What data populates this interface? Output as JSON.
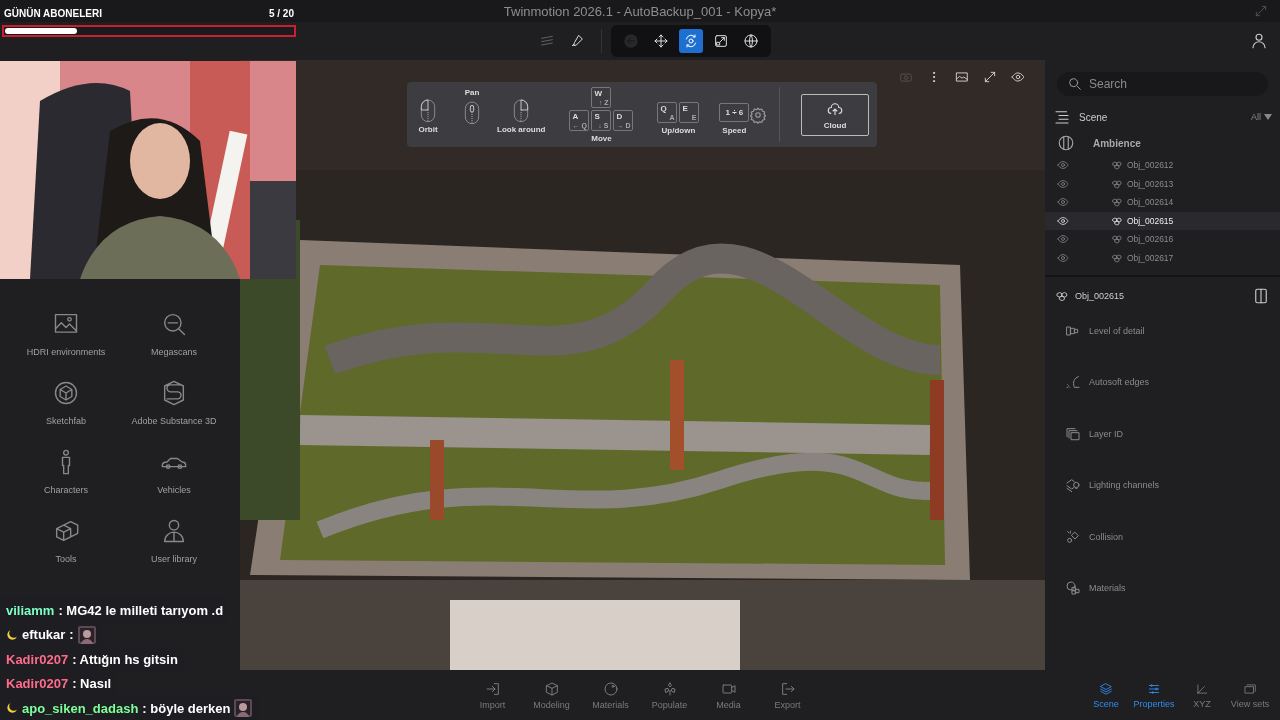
{
  "title_bar": {
    "title": "Twinmotion 2026.1 - AutoBackup_001 - Kopya*"
  },
  "toolbar": {
    "tools": [
      {
        "selected": false,
        "disabled": true
      },
      {
        "selected": false,
        "disabled": false
      },
      {
        "selected": false,
        "disabled": true
      },
      {
        "selected": false,
        "disabled": false
      },
      {
        "selected": true,
        "disabled": false
      },
      {
        "selected": false,
        "disabled": false
      },
      {
        "selected": false,
        "disabled": false
      }
    ]
  },
  "library": {
    "items": [
      {
        "label": "HDRI environments"
      },
      {
        "label": "Megascans"
      },
      {
        "label": "Sketchfab"
      },
      {
        "label": "Adobe Substance 3D"
      },
      {
        "label": "Characters"
      },
      {
        "label": "Vehicles"
      },
      {
        "label": "Tools"
      },
      {
        "label": "User library"
      }
    ]
  },
  "navigation": {
    "orbit": "Orbit",
    "pan": "Pan",
    "look_around": "Look around",
    "move": {
      "label": "Move",
      "keys": [
        {
          "key": "W",
          "hint": "↑ Z"
        },
        {
          "key": "A",
          "hint": "← Q"
        },
        {
          "key": "S",
          "hint": "↓ S"
        },
        {
          "key": "D",
          "hint": "→ D"
        }
      ]
    },
    "up_down": {
      "label": "Up/down",
      "keys": [
        {
          "key": "Q",
          "hint": "A"
        },
        {
          "key": "E",
          "hint": "E"
        }
      ]
    },
    "speed": {
      "label": "Speed",
      "value": "1 ÷ 6"
    },
    "cloud": "Cloud"
  },
  "right_panel": {
    "search": {
      "placeholder": "Search"
    },
    "scene": {
      "label": "Scene",
      "filter": "All"
    },
    "group": "Ambience",
    "objects": [
      {
        "name": "Obj_002612",
        "selected": false
      },
      {
        "name": "Obj_002613",
        "selected": false
      },
      {
        "name": "Obj_002614",
        "selected": false
      },
      {
        "name": "Obj_002615",
        "selected": true
      },
      {
        "name": "Obj_002616",
        "selected": false
      },
      {
        "name": "Obj_002617",
        "selected": false
      }
    ],
    "properties": {
      "title": "Obj_002615",
      "items": [
        {
          "label": "Level of detail"
        },
        {
          "label": "Autosoft edges"
        },
        {
          "label": "Layer ID"
        },
        {
          "label": "Lighting channels"
        },
        {
          "label": "Collision"
        },
        {
          "label": "Materials"
        }
      ]
    }
  },
  "bottom_bar": {
    "tools": [
      {
        "label": "Import"
      },
      {
        "label": "Modeling"
      },
      {
        "label": "Materials"
      },
      {
        "label": "Populate"
      },
      {
        "label": "Media"
      },
      {
        "label": "Export"
      }
    ],
    "tabs": [
      {
        "label": "Scene",
        "selected": true
      },
      {
        "label": "Properties",
        "selected": true
      },
      {
        "label": "XYZ",
        "selected": false
      },
      {
        "label": "View sets",
        "selected": false
      }
    ]
  },
  "sub_goal": {
    "title": "GÜNÜN ABONELERI",
    "count": "5 / 20",
    "level": 0.25
  },
  "chat": [
    {
      "user": "viliamm",
      "color": "#7dffc8",
      "badge": false,
      "text": ": MG42 le milleti tarıyom .d",
      "emote": false
    },
    {
      "user": "eftukar",
      "color": "#ffffff",
      "badge": true,
      "text": ":",
      "emote": true
    },
    {
      "user": "Kadir0207",
      "color": "#ff6b8b",
      "badge": false,
      "text": ": Attığın hs gitsin",
      "emote": false
    },
    {
      "user": "Kadir0207",
      "color": "#ff6b8b",
      "badge": false,
      "text": ": Nasıl",
      "emote": false
    },
    {
      "user": "apo_siken_dadash",
      "color": "#7dff9a",
      "badge": true,
      "text": ": böyle derken",
      "emote": true
    }
  ]
}
